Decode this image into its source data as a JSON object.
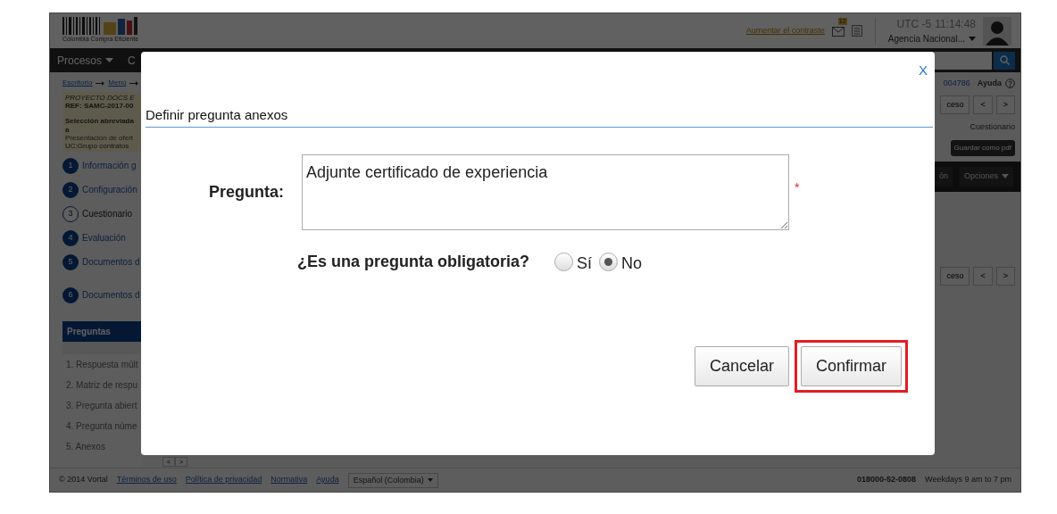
{
  "header": {
    "logo_text": "Colombia Compra Eficiente",
    "contrast_link": "Aumentar el contraste",
    "mail_badge": "12",
    "time_zone": "UTC -5",
    "time": "11:14:48",
    "agency": "Agencia Nacional..."
  },
  "nav": {
    "items": [
      "Procesos",
      "C"
    ]
  },
  "breadcrumb": [
    "Escritorio",
    "Menú"
  ],
  "process": {
    "title": "PROYECTO DOCS E",
    "ref": "REF: SAMC-2017-00",
    "type": "Selección abreviada",
    "type_cont": "a",
    "phase": "Presentación de ofert",
    "unit": "UC:Grupo contratos"
  },
  "steps": [
    {
      "number": "1",
      "label": "Información g",
      "selected": false
    },
    {
      "number": "2",
      "label": "Configuración",
      "selected": false
    },
    {
      "number": "3",
      "label": "Cuestionario",
      "selected": true
    },
    {
      "number": "4",
      "label": "Evaluación",
      "selected": false
    },
    {
      "number": "5",
      "label": "Documentos d",
      "selected": false
    },
    {
      "number": "6",
      "label": "Documentos d",
      "selected": false
    }
  ],
  "questions_panel": {
    "title": "Preguntas",
    "items": [
      {
        "number": "1.",
        "label": "Respuesta múlt"
      },
      {
        "number": "2.",
        "label": "Matriz de respu"
      },
      {
        "number": "3.",
        "label": "Pregunta abiert"
      },
      {
        "number": "4.",
        "label": "Pregunta núme"
      },
      {
        "number": "5.",
        "label": "Anexos"
      }
    ]
  },
  "pager_small": [
    "<",
    ">"
  ],
  "right_panel": {
    "ref": "004786",
    "help": "Ayuda",
    "top_pager": [
      "ceso",
      "<",
      ">"
    ],
    "section": "Cuestionario",
    "pdf_button": "Guardar como pdf",
    "toolbar": [
      "ón",
      "Opciones"
    ],
    "bottom_pager": [
      "ceso",
      "<",
      ">"
    ]
  },
  "footer": {
    "copyright": "© 2014 Vortal",
    "links": [
      "Términos de uso",
      "Política de privacidad",
      "Normativa",
      "Ayuda"
    ],
    "language": "Español (Colombia)",
    "phone": "018000-52-0808",
    "hours": "Weekdays 9 am to 7 pm"
  },
  "modal": {
    "close": "X",
    "title": "Definir pregunta anexos",
    "question_label": "Pregunta:",
    "question_value": "Adjunte certificado de experiencia",
    "required_mark": "*",
    "mandatory_label": "¿Es una pregunta obligatoria?",
    "options": [
      {
        "label": "Sí",
        "selected": false
      },
      {
        "label": "No",
        "selected": true
      }
    ],
    "buttons": [
      {
        "label": "Cancelar",
        "highlighted": false
      },
      {
        "label": "Confirmar",
        "highlighted": true
      }
    ]
  }
}
